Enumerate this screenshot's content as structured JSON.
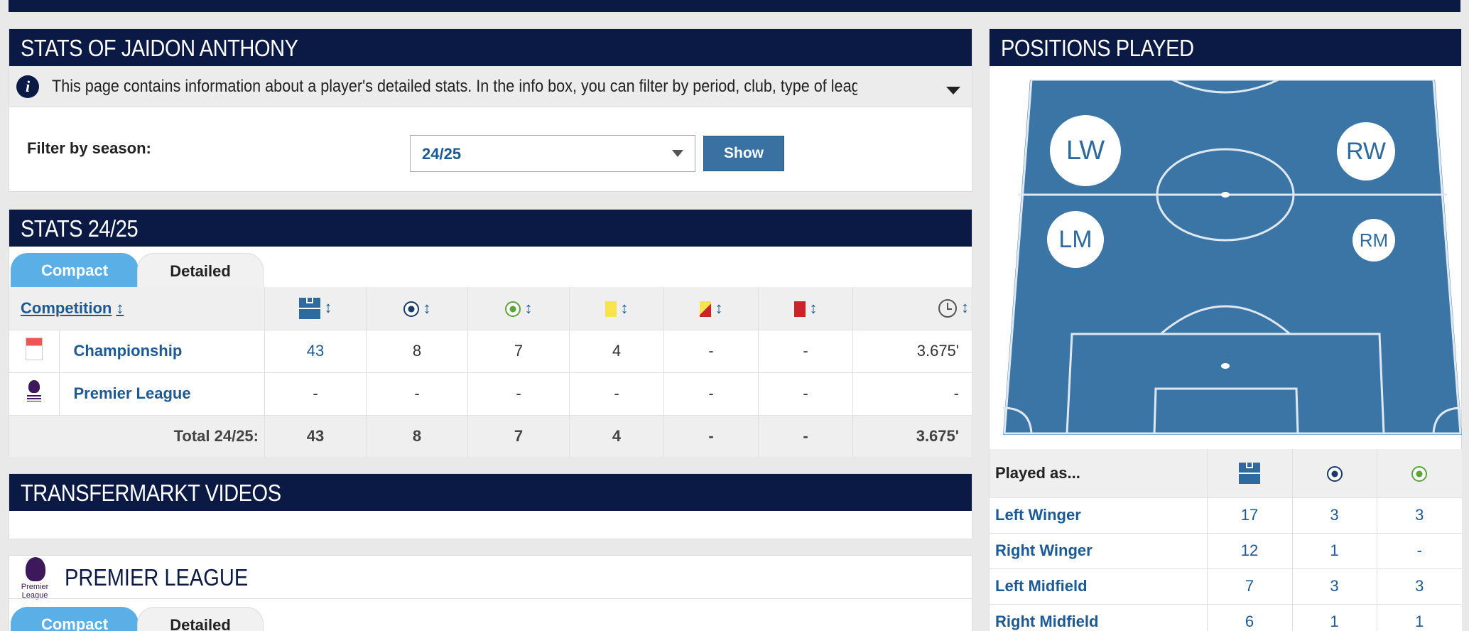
{
  "stats_box": {
    "title": "STATS OF JAIDON ANTHONY",
    "info_text": "This page contains information about a player's detailed stats. In the info box, you can filter by period, club, type of league and competition. Th...",
    "filter_label": "Filter by season:",
    "season_value": "24/25",
    "show_label": "Show"
  },
  "season_stats": {
    "title": "STATS 24/25",
    "tabs": [
      "Compact",
      "Detailed"
    ],
    "competition_header": "Competition",
    "sort_glyph": "↕",
    "rows": [
      {
        "name": "Championship",
        "apps": "43",
        "goals": "8",
        "assists": "7",
        "yellow": "4",
        "second_yellow": "-",
        "red": "-",
        "minutes": "3.675'"
      },
      {
        "name": "Premier League",
        "apps": "-",
        "goals": "-",
        "assists": "-",
        "yellow": "-",
        "second_yellow": "-",
        "red": "-",
        "minutes": "-"
      }
    ],
    "total": {
      "label": "Total 24/25:",
      "apps": "43",
      "goals": "8",
      "assists": "7",
      "yellow": "4",
      "second_yellow": "-",
      "red": "-",
      "minutes": "3.675'"
    }
  },
  "videos": {
    "title": "TRANSFERMARKT VIDEOS"
  },
  "premier_league": {
    "title": "PREMIER LEAGUE",
    "logo_text": "Premier League",
    "tabs": [
      "Compact",
      "Detailed"
    ]
  },
  "positions": {
    "title": "POSITIONS PLAYED",
    "markers": {
      "lw": "LW",
      "rw": "RW",
      "lm": "LM",
      "rm": "RM"
    },
    "played_as_label": "Played as...",
    "rows": [
      {
        "position": "Left Winger",
        "apps": "17",
        "goals": "3",
        "assists": "3"
      },
      {
        "position": "Right Winger",
        "apps": "12",
        "goals": "1",
        "assists": "-"
      },
      {
        "position": "Left Midfield",
        "apps": "7",
        "goals": "3",
        "assists": "3"
      },
      {
        "position": "Right Midfield",
        "apps": "6",
        "goals": "1",
        "assists": "1"
      }
    ]
  },
  "colors": {
    "navy": "#0b1a44",
    "link": "#1d5a94",
    "pitch": "#3a75a6",
    "tab_active": "#5ab0e6"
  }
}
